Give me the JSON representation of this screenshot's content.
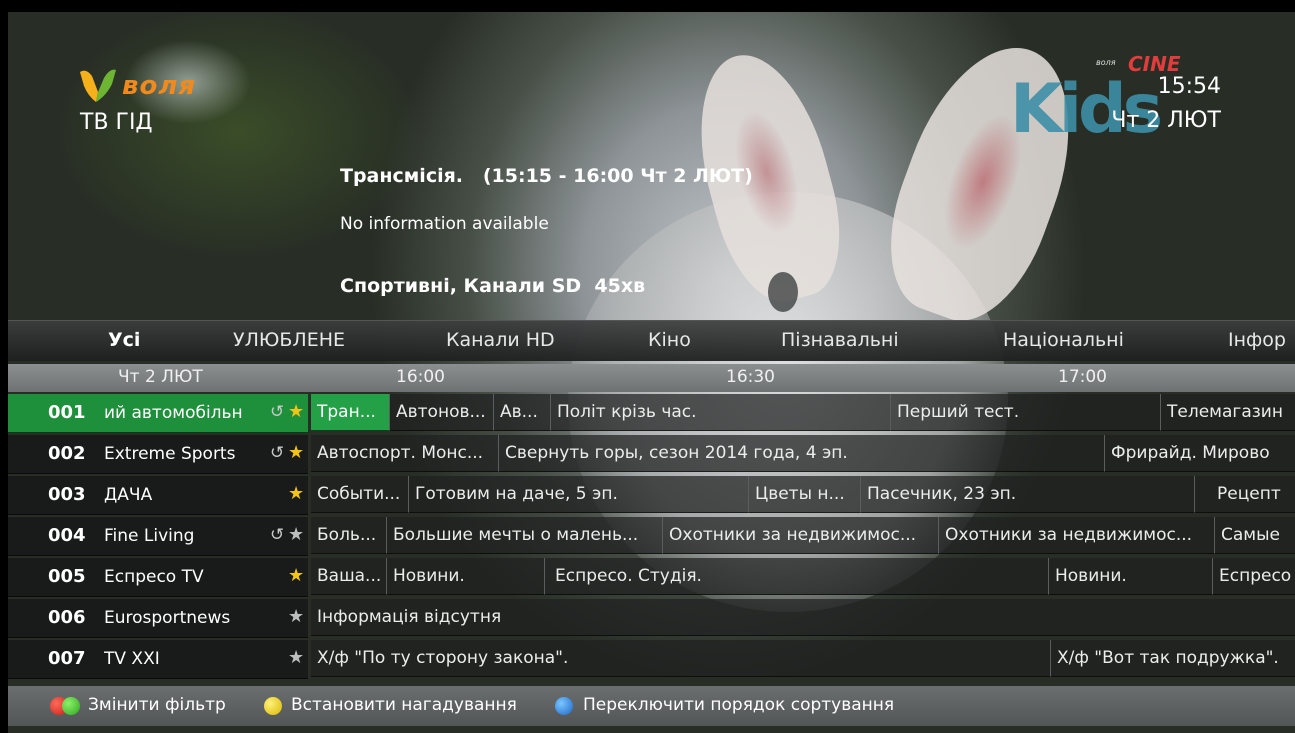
{
  "header": {
    "logo_text": "воля",
    "guide_title": "ТВ ГІД",
    "time": "15:54",
    "date": "Чт 2 ЛЮТ",
    "channel_logo": {
      "main": "Kids",
      "cine": "CINE",
      "volya": "воля"
    }
  },
  "program_info": {
    "title": "Трансмісія.   (15:15 - 16:00 Чт 2 ЛЮТ)",
    "description": "No information available",
    "category": "Спортивні, Канали SD  45хв"
  },
  "tabs": [
    "Усі",
    "УЛЮБЛЕНЕ",
    "Канали HD",
    "Кіно",
    "Пізнавальні",
    "Національні",
    "Інфор"
  ],
  "active_tab": "Усі",
  "timeline": {
    "date": "Чт 2 ЛЮТ",
    "slots": [
      "16:00",
      "16:30",
      "17:00"
    ]
  },
  "channels": [
    {
      "number": "001",
      "name": "ий автомобільн",
      "replay": true,
      "favorite": true,
      "selected": true,
      "programs": [
        "Тран...",
        "Автонов...",
        "Ав...",
        "Політ крізь час.",
        "Перший тест.",
        "Телемагазин"
      ]
    },
    {
      "number": "002",
      "name": "Extreme Sports",
      "replay": true,
      "favorite": true,
      "selected": false,
      "programs": [
        "Автоспорт. Монс...",
        "Свернуть горы, сезон 2014 года, 4 эп.",
        "Фрирайд. Мирово"
      ]
    },
    {
      "number": "003",
      "name": "ДАЧА",
      "replay": false,
      "favorite": true,
      "selected": false,
      "programs": [
        "Событи...",
        "Готовим на даче, 5 эп.",
        "Цветы н...",
        "Пасечник, 23 эп.",
        "Рецепт"
      ]
    },
    {
      "number": "004",
      "name": "Fine Living",
      "replay": true,
      "favorite": false,
      "selected": false,
      "programs": [
        "Боль...",
        "Большие мечты о малень...",
        "Охотники за недвижимос...",
        "Охотники за недвижимос...",
        "Самые"
      ]
    },
    {
      "number": "005",
      "name": "Еспресо TV",
      "replay": false,
      "favorite": true,
      "selected": false,
      "programs": [
        "Ваша...",
        "Новини.",
        "Еспресо. Студія.",
        "Новини.",
        "Еспресо"
      ]
    },
    {
      "number": "006",
      "name": "Eurosportnews",
      "replay": false,
      "favorite": false,
      "selected": false,
      "programs": [
        "Інформація відсутня"
      ]
    },
    {
      "number": "007",
      "name": "TV XXI",
      "replay": false,
      "favorite": false,
      "selected": false,
      "programs": [
        "Х/ф \"По ту сторону закона\".",
        "Х/ф \"Вот так подружка\"."
      ]
    }
  ],
  "footer": {
    "change_filter": "Змінити фільтр",
    "set_reminder": "Встановити нагадування",
    "toggle_sort": "Переключити порядок сортування"
  },
  "colors": {
    "accent_green": "#1e8f3a",
    "current_program": "#24a046",
    "favorite_star": "#f2c418",
    "logo_orange": "#f08a1c"
  }
}
